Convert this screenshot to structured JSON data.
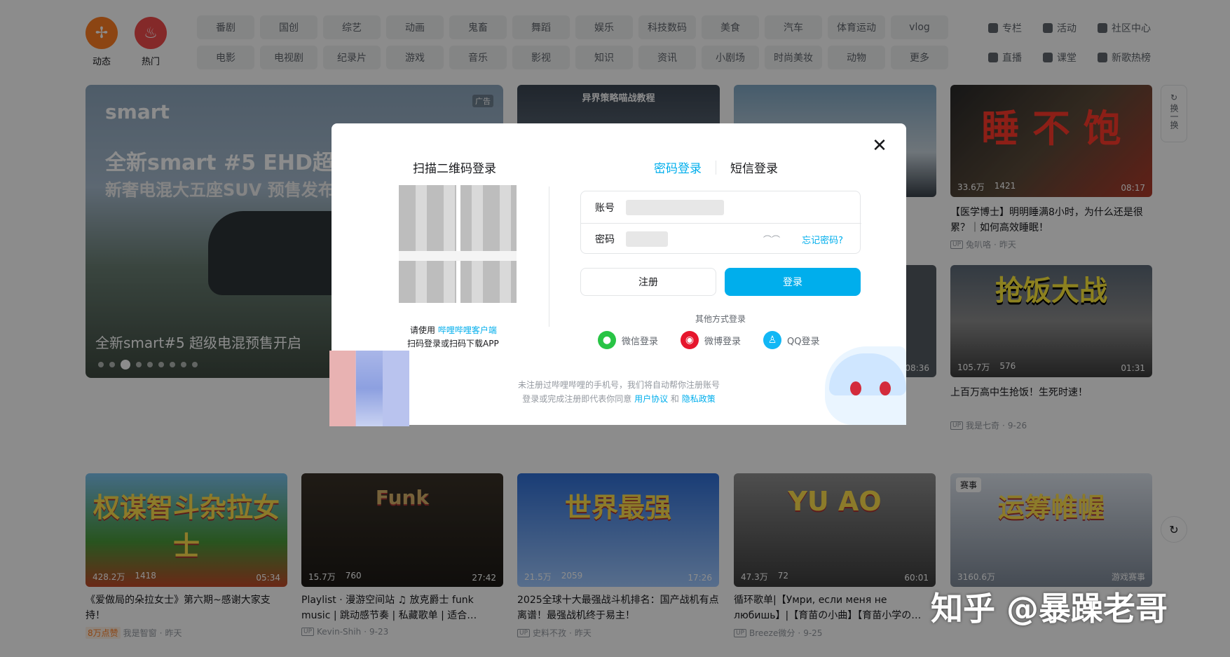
{
  "header": {
    "dynamic": {
      "label": "动态",
      "icon": "pinwheel-icon"
    },
    "hot": {
      "label": "热门",
      "icon": "fire-icon"
    },
    "row1": [
      "番剧",
      "国创",
      "综艺",
      "动画",
      "鬼畜",
      "舞蹈",
      "娱乐",
      "科技数码",
      "美食",
      "汽车",
      "体育运动",
      "vlog"
    ],
    "row2": [
      "电影",
      "电视剧",
      "纪录片",
      "游戏",
      "音乐",
      "影视",
      "知识",
      "资讯",
      "小剧场",
      "时尚美妆",
      "动物",
      "更多"
    ],
    "right_links": [
      "专栏",
      "活动",
      "社区中心",
      "直播",
      "课堂",
      "新歌热榜"
    ]
  },
  "banner": {
    "brand": "smart",
    "ad_tag": "广告",
    "headline": "全新smart #5 EHD超级电",
    "subline": "新奢电混大五座SUV 预售发布",
    "caption": "全新smart#5 超级电混预售开启",
    "dots": 9,
    "active_dot": 3
  },
  "top_cards": {
    "c1_overlay": "异界策略喵战教程",
    "c4": {
      "overlay": "睡 不 饱",
      "plays": "33.6万",
      "comments": "1421",
      "duration": "08:17",
      "title": "【医学博士】明明睡满8小时，为什么还是很累？｜如何高效睡眠！",
      "up": "兔叭咯",
      "date": "昨天"
    },
    "c8": {
      "overlay": "抢饭大战",
      "plays": "105.7万",
      "comments": "576",
      "duration": "01:31",
      "title": "上百万高中生抢饭！生死时速！",
      "up": "我是七奇",
      "date": "9-26"
    },
    "c7_duration": "08:36"
  },
  "swap": {
    "label": "换一换"
  },
  "bottom_cards": [
    {
      "plays": "428.2万",
      "comments": "1418",
      "duration": "05:34",
      "title": "《爱做局的朵拉女士》第六期~感谢大家支持！",
      "hot_badge": "8万点赞",
      "up": "我是智窗",
      "date": "昨天",
      "overlay": "权谋智斗杂拉女士"
    },
    {
      "plays": "15.7万",
      "comments": "760",
      "duration": "27:42",
      "title": "Playlist · 漫游空间站 ♫ 放克爵士 funk music | 跳动感节奏 | 私藏歌单 | 适合…",
      "up": "Kevin-Shih",
      "date": "9-23",
      "overlay": "Funk"
    },
    {
      "plays": "21.5万",
      "comments": "2059",
      "duration": "17:26",
      "title": "2025全球十大最强战斗机排名：国产战机有点离谱！最强战机终于易主！",
      "up": "史料不孜",
      "date": "昨天",
      "overlay": "世界最强"
    },
    {
      "plays": "47.3万",
      "comments": "72",
      "duration": "60:01",
      "title": "循环歌单|【Умри, если меня не любишь】|【育苗の小曲】【育苗小学の…",
      "up": "Breeze微分",
      "date": "9-25",
      "overlay": "YU AO"
    },
    {
      "plays": "3160.6万",
      "tag": "游戏赛事",
      "badge": "赛事",
      "overlay": "运筹帷幄"
    }
  ],
  "modal": {
    "qr_title": "扫描二维码登录",
    "qr_tip_prefix": "请使用",
    "qr_tip_link": "哔哩哔哩客户端",
    "qr_tip_line2": "扫码登录或扫码下载APP",
    "tab_password": "密码登录",
    "tab_sms": "短信登录",
    "account_label": "账号",
    "password_label": "密码",
    "forgot": "忘记密码?",
    "register": "注册",
    "login": "登录",
    "other_methods": "其他方式登录",
    "wechat": "微信登录",
    "weibo": "微博登录",
    "qq": "QQ登录",
    "agree_line1": "未注册过哔哩哔哩的手机号，我们将自动帮你注册账号",
    "agree_line2_prefix": "登录或完成注册即代表你同意",
    "agree_link1": "用户协议",
    "agree_and": "和",
    "agree_link2": "隐私政策"
  },
  "watermark": "知乎 @暴躁老哥",
  "colors": {
    "accent": "#00aeec",
    "dynamic": "#ff7f24",
    "hot": "#f04b4b",
    "wechat": "#28c445",
    "weibo": "#e6162d",
    "qq": "#12b7f5"
  }
}
